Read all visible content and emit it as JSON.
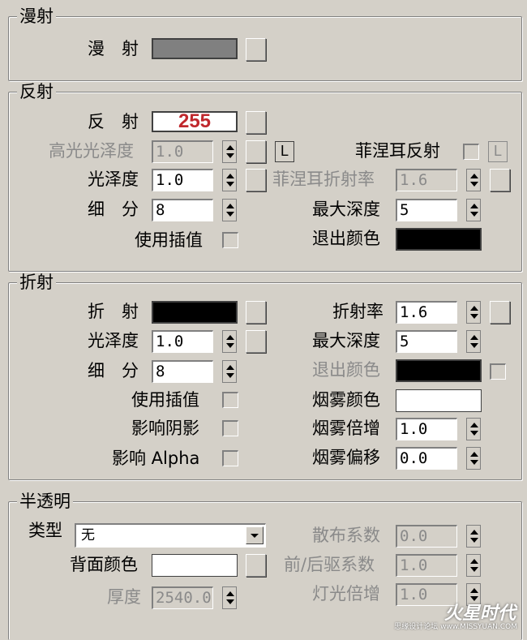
{
  "diffuse": {
    "title": "漫射",
    "label": "漫　射",
    "color": "#808080"
  },
  "reflection": {
    "title": "反射",
    "label": "反　射",
    "value_text": "255",
    "color": "#ffffff",
    "value_color": "#c0282d",
    "hilight_label": "高光光泽度",
    "hilight_value": "1.0",
    "lock_label": "L",
    "fresnel_label": "菲涅耳反射",
    "fresnel_lock_label": "L",
    "gloss_label": "光泽度",
    "gloss_value": "1.0",
    "fresnel_ior_label": "菲涅耳折射率",
    "fresnel_ior_value": "1.6",
    "subdivs_label": "细　分",
    "subdivs_value": "8",
    "max_depth_label": "最大深度",
    "max_depth_value": "5",
    "interp_label": "使用插值",
    "exit_color_label": "退出颜色",
    "exit_color": "#000000"
  },
  "refraction": {
    "title": "折射",
    "label": "折　射",
    "color": "#000000",
    "ior_label": "折射率",
    "ior_value": "1.6",
    "gloss_label": "光泽度",
    "gloss_value": "1.0",
    "max_depth_label": "最大深度",
    "max_depth_value": "5",
    "subdivs_label": "细　分",
    "subdivs_value": "8",
    "exit_color_label": "退出颜色",
    "exit_color": "#000000",
    "interp_label": "使用插值",
    "fog_color_label": "烟雾颜色",
    "fog_color": "#ffffff",
    "affect_shadows_label": "影响阴影",
    "fog_mult_label": "烟雾倍增",
    "fog_mult_value": "1.0",
    "affect_alpha_label": "影响 Alpha",
    "fog_bias_label": "烟雾偏移",
    "fog_bias_value": "0.0"
  },
  "translucency": {
    "title": "半透明",
    "type_label": "类型",
    "type_value": "无",
    "scatter_label": "散布系数",
    "scatter_value": "0.0",
    "back_color_label": "背面颜色",
    "back_color": "#ffffff",
    "fb_label": "前/后驱系数",
    "fb_value": "1.0",
    "thickness_label": "厚度",
    "thickness_value": "2540.0",
    "light_mult_label": "灯光倍增",
    "light_mult_value": "1.0"
  },
  "watermark": {
    "text": "火星时代",
    "sub": "思缘设计论坛 www.MISSYUAN.COM"
  }
}
